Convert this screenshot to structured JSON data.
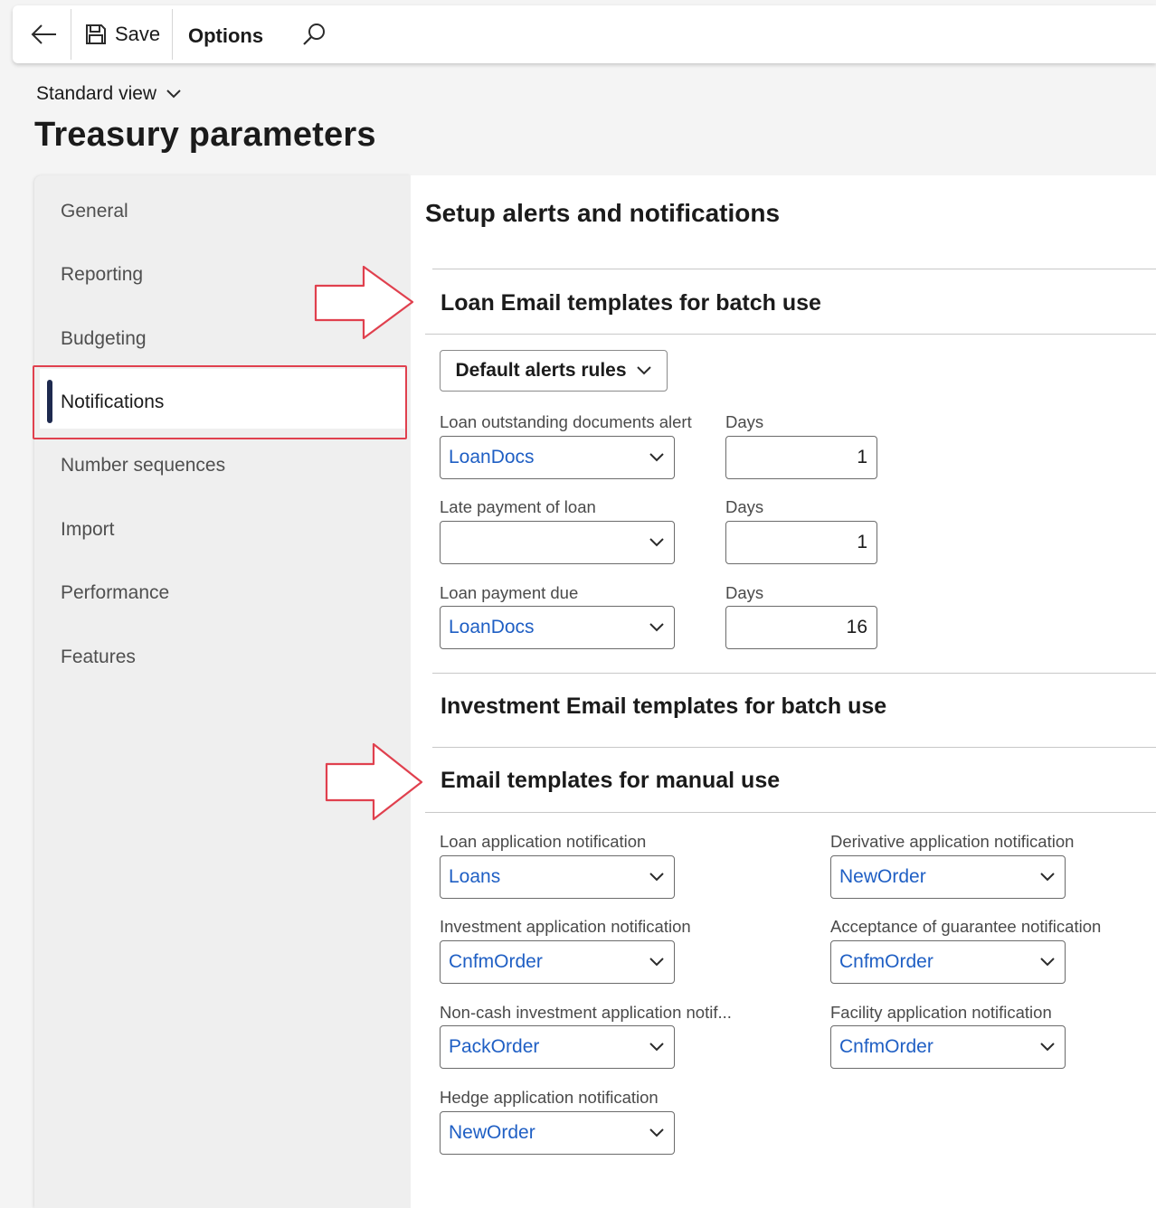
{
  "toolbar": {
    "save_label": "Save",
    "options_label": "Options"
  },
  "header": {
    "view_label": "Standard view",
    "page_title": "Treasury parameters"
  },
  "nav": {
    "items": [
      {
        "label": "General"
      },
      {
        "label": "Reporting"
      },
      {
        "label": "Budgeting"
      },
      {
        "label": "Notifications",
        "selected": true
      },
      {
        "label": "Number sequences"
      },
      {
        "label": "Import"
      },
      {
        "label": "Performance"
      },
      {
        "label": "Features"
      }
    ]
  },
  "main": {
    "section_title": "Setup alerts and notifications",
    "loan_batch": {
      "title": "Loan Email templates for batch use",
      "menu_button": "Default alerts rules",
      "fields": [
        {
          "label": "Loan outstanding documents alert",
          "value": "LoanDocs",
          "days_label": "Days",
          "days": "1"
        },
        {
          "label": "Late payment of loan",
          "value": "",
          "days_label": "Days",
          "days": "1"
        },
        {
          "label": "Loan payment due",
          "value": "LoanDocs",
          "days_label": "Days",
          "days": "16"
        }
      ]
    },
    "investment_batch": {
      "title": "Investment Email templates for batch use"
    },
    "manual": {
      "title": "Email templates for manual use",
      "left": [
        {
          "label": "Loan application notification",
          "value": "Loans"
        },
        {
          "label": "Investment application notification",
          "value": "CnfmOrder"
        },
        {
          "label": "Non-cash investment application notif...",
          "value": "PackOrder"
        },
        {
          "label": "Hedge application notification",
          "value": "NewOrder"
        }
      ],
      "right": [
        {
          "label": "Derivative application notification",
          "value": "NewOrder"
        },
        {
          "label": "Acceptance of guarantee notification",
          "value": "CnfmOrder"
        },
        {
          "label": "Facility application notification",
          "value": "CnfmOrder"
        }
      ]
    }
  },
  "colors": {
    "link_value": "#1f5fc4",
    "annotation_red": "#e0404e",
    "nav_indicator": "#1e2a4f"
  },
  "icons": [
    "back-arrow-icon",
    "save-icon",
    "search-icon",
    "chevron-down-icon",
    "annotation-arrow"
  ]
}
